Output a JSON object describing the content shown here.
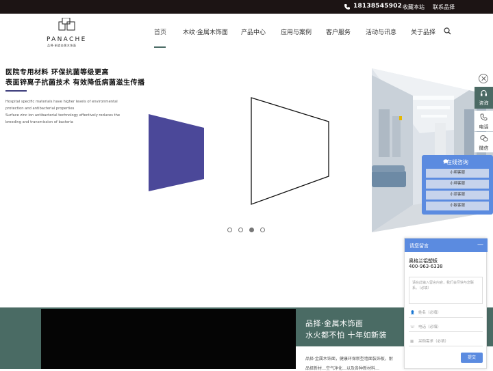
{
  "topbar": {
    "phone": "18138545902",
    "favorite": "收藏本站",
    "contact": "联系品择"
  },
  "logo": {
    "brand": "PANACHE",
    "tagline": "品择·制造金属木饰面"
  },
  "nav": [
    "首页",
    "木纹·金属木饰面",
    "产品中心",
    "应用与案例",
    "客户服务",
    "活动与讯息",
    "关于品择"
  ],
  "hero": {
    "title1": "医院专用材料 环保抗菌等级更高",
    "title2": "表面锌离子抗菌技术 有效降低病菌滋生传播",
    "en1": "Hospital specific materials have higher levels of environmental",
    "en2": "protection and antibacterial properties",
    "en3": "Surface zinc ion antibacterial technology effectively reduces the",
    "en4": "breeding and transmission of bacteria",
    "slide_count": 4,
    "active_slide": 3
  },
  "side": {
    "consult": "咨询",
    "phone": "电话",
    "wechat": "微信"
  },
  "chat": {
    "title": "在线咨询",
    "agents": [
      "小明客服",
      "小坤客服",
      "小菲客服",
      "小敏客服"
    ]
  },
  "message": {
    "title": "请您留言",
    "minimize": "—",
    "company": "奥格兰铝塑板",
    "tel": "400-963-6338",
    "content_placeholder": "请在此输入留言内容，我们会尽快与您联系。（必填）",
    "name_placeholder": "姓名（必填）",
    "phone_placeholder": "电话（必填）",
    "need_placeholder": "采购需求（必填）",
    "submit": "提交"
  },
  "band": {
    "title1": "品择·金属木饰面",
    "title2": "水火都不怕 十年如新装",
    "desc1": "品择·金属木饰面，健康环保新型墙面装饰板，耐",
    "desc2": "品择新材…空气净化…以及各种新材料…"
  },
  "colors": {
    "accent": "#4a6b64",
    "purple": "#4b4899",
    "chat_blue": "#5b8be0"
  }
}
